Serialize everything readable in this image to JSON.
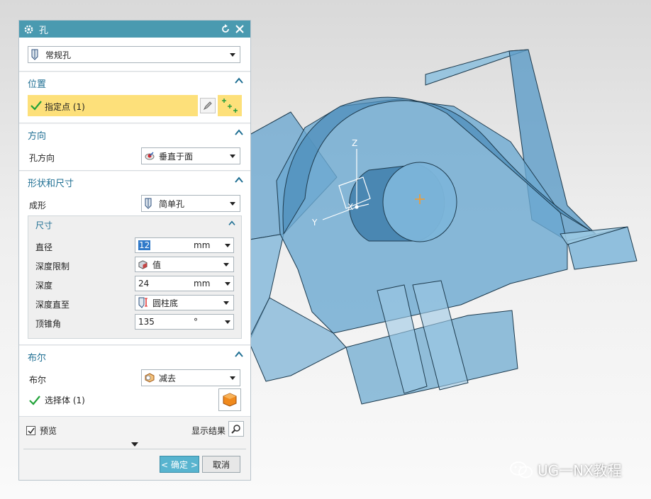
{
  "dialog": {
    "title": "孔",
    "type_select": {
      "value": "常规孔"
    },
    "sections": {
      "position": {
        "title": "位置",
        "specify_point": "指定点 (1)"
      },
      "direction": {
        "title": "方向",
        "hole_direction_label": "孔方向",
        "hole_direction_value": "垂直于面"
      },
      "shape": {
        "title": "形状和尺寸",
        "form_label": "成形",
        "form_value": "简单孔",
        "dimensions": {
          "title": "尺寸",
          "diameter_label": "直径",
          "diameter_value": "12",
          "diameter_unit": "mm",
          "depth_limit_label": "深度限制",
          "depth_limit_value": "值",
          "depth_label": "深度",
          "depth_value": "24",
          "depth_unit": "mm",
          "depth_to_label": "深度直至",
          "depth_to_value": "圆柱底",
          "tip_angle_label": "顶锥角",
          "tip_angle_value": "135",
          "tip_angle_unit": "°"
        }
      },
      "boolean": {
        "title": "布尔",
        "boolean_label": "布尔",
        "boolean_value": "减去",
        "select_body": "选择体 (1)"
      }
    },
    "preview_label": "预览",
    "preview_checked": true,
    "show_result_label": "显示结果",
    "ok_label": "< 确定 >",
    "cancel_label": "取消"
  },
  "viewport": {
    "triad": {
      "x": "X",
      "y": "Y",
      "z": "Z"
    }
  },
  "watermark": "UG一NX教程",
  "colors": {
    "title_bar": "#4a9ab0",
    "section_title": "#1f6f93",
    "highlight": "#fde07a",
    "model_fill": "#6aa7cf",
    "ok_button": "#58b4cf"
  }
}
